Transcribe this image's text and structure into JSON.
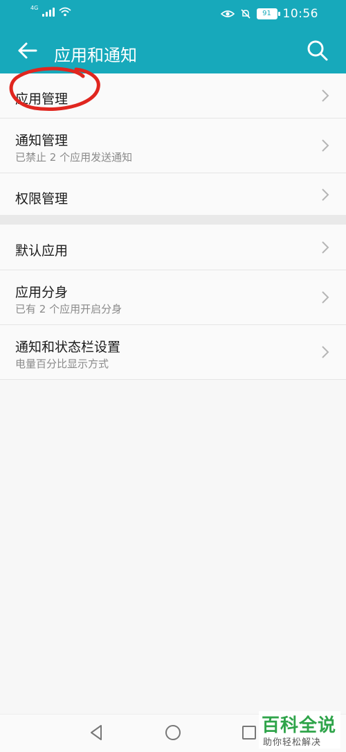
{
  "status_bar": {
    "network_type": "4G",
    "battery_level": "91",
    "time": "10:56",
    "icons": [
      "signal-icon",
      "wifi-icon",
      "eye-comfort-icon",
      "mute-icon",
      "battery-icon"
    ]
  },
  "header": {
    "title": "应用和通知",
    "back_icon": "back-arrow-icon",
    "search_icon": "search-icon",
    "accent_color": "#17a9bb"
  },
  "settings": {
    "group1": [
      {
        "label": "应用管理"
      },
      {
        "label": "通知管理",
        "sub": "已禁止 2 个应用发送通知"
      },
      {
        "label": "权限管理"
      }
    ],
    "group2": [
      {
        "label": "默认应用"
      },
      {
        "label": "应用分身",
        "sub": "已有 2 个应用开启分身"
      },
      {
        "label": "通知和状态栏设置",
        "sub": "电量百分比显示方式"
      }
    ]
  },
  "annotation": {
    "shape": "red-circle",
    "target": "应用管理",
    "color": "#e0261f"
  },
  "navbar": {
    "icons": [
      "back-triangle-icon",
      "home-circle-icon",
      "recents-square-icon"
    ]
  },
  "watermark": {
    "title": "百科全说",
    "subtitle": "助你轻松解决",
    "color": "#2fa44a"
  }
}
